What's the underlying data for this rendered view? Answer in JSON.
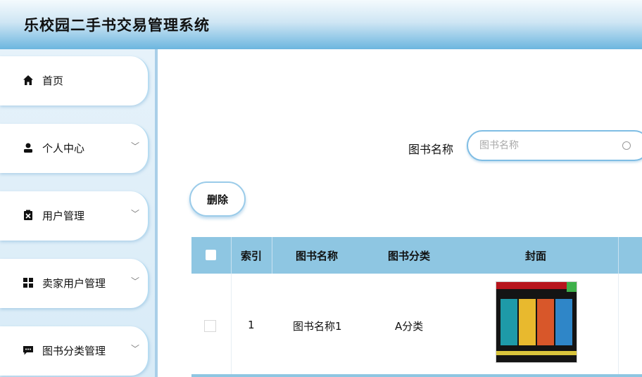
{
  "app": {
    "title": "乐校园二手书交易管理系统"
  },
  "sidebar": {
    "items": [
      {
        "label": "首页",
        "icon": "home-icon",
        "expandable": false
      },
      {
        "label": "个人中心",
        "icon": "user-icon",
        "expandable": true
      },
      {
        "label": "用户管理",
        "icon": "clipboard-icon",
        "expandable": true
      },
      {
        "label": "卖家用户管理",
        "icon": "grid-icon",
        "expandable": true
      },
      {
        "label": "图书分类管理",
        "icon": "chat-icon",
        "expandable": true
      }
    ]
  },
  "search": {
    "label": "图书名称",
    "placeholder": "图书名称"
  },
  "toolbar": {
    "delete_label": "删除"
  },
  "table": {
    "columns": [
      "索引",
      "图书名称",
      "图书分类",
      "封面"
    ],
    "rows": [
      {
        "index": "1",
        "name": "图书名称1",
        "category": "A分类",
        "cover": "book-cover-image"
      }
    ]
  },
  "colors": {
    "header_gradient_end": "#6cb6df",
    "table_header": "#8ec6e2",
    "accent_border": "#7fbde4"
  }
}
